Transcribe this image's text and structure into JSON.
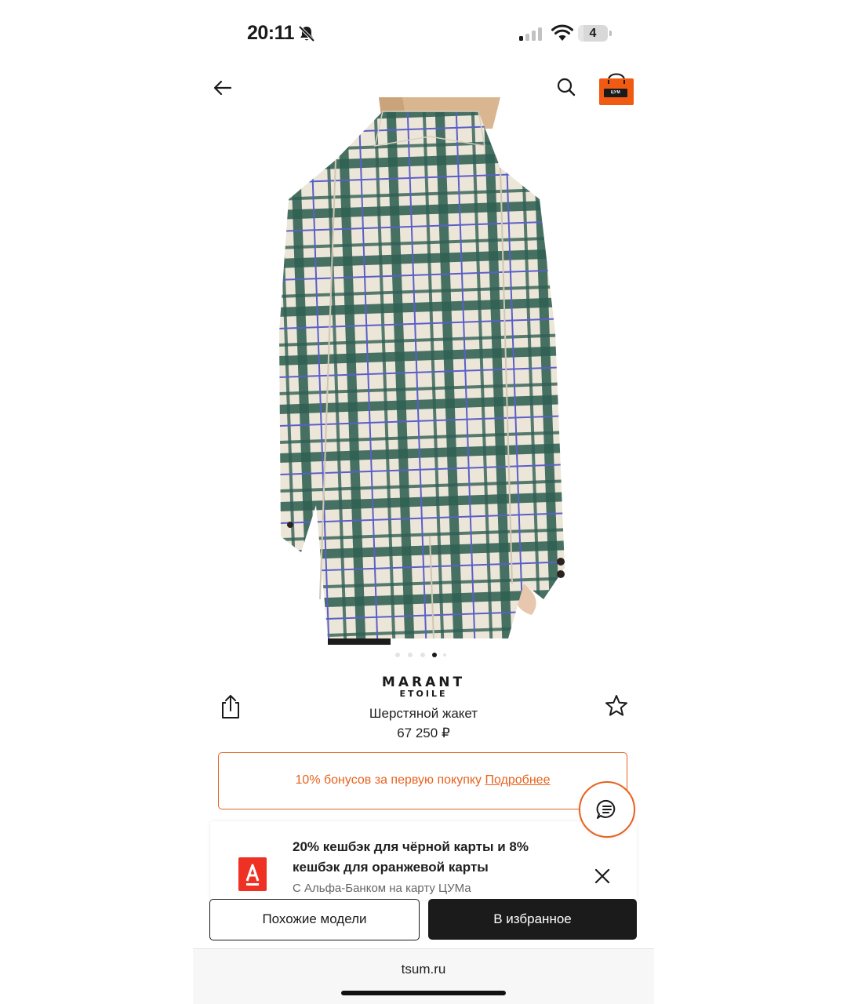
{
  "status_bar": {
    "time": "20:11",
    "battery": "4"
  },
  "header": {
    "back": "back",
    "search": "search",
    "bag": "shopping-bag"
  },
  "gallery": {
    "image_count": 5,
    "active_index": 3
  },
  "product": {
    "brand_line1": "MARANT",
    "brand_line2": "ETOILE",
    "name": "Шерстяной жакет",
    "price": "67 250 ₽"
  },
  "bonus_banner": {
    "text": "10% бонусов за первую покупку",
    "link": "Подробнее"
  },
  "cashback": {
    "title": "20% кешбэк для чёрной карты и 8% кешбэк для оранжевой карты",
    "subtitle": "С Альфа-Банком на карту ЦУМа"
  },
  "actions": {
    "similar": "Похожие модели",
    "favorite": "В избранное"
  },
  "browser": {
    "url": "tsum.ru"
  },
  "colors": {
    "accent": "#e8621f",
    "alfa_red": "#ef3124",
    "dark": "#1b1b1b"
  }
}
